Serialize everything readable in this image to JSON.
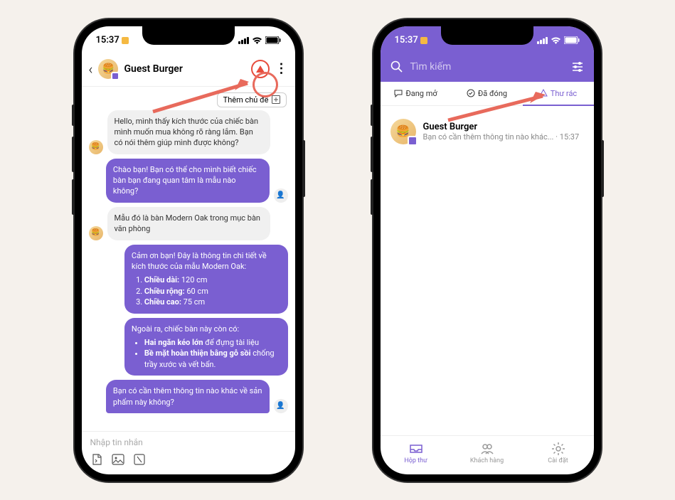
{
  "status": {
    "time": "15:37",
    "yellow_square": "◧"
  },
  "left": {
    "header": {
      "title": "Guest Burger",
      "add_topic": "Thêm chủ đề"
    },
    "messages": {
      "m1": "Hello, mình thấy kích thước của chiếc bàn mình muốn mua không rõ ràng lắm. Bạn có nói thêm giúp mình được không?",
      "m2": "Chào bạn! Bạn có thể cho mình biết chiếc bàn bạn đang quan tâm là mẫu nào không?",
      "m3": "Mẫu đó là bàn Modern Oak trong mục bàn văn phòng",
      "m4_intro": "Cảm ơn bạn! Đây là thông tin chi tiết về kích thước của mẫu Modern Oak:",
      "m4_d1_k": "Chiều dài:",
      "m4_d1_v": " 120 cm",
      "m4_d2_k": "Chiều rộng:",
      "m4_d2_v": " 60 cm",
      "m4_d3_k": "Chiều cao:",
      "m4_d3_v": " 75 cm",
      "m5_intro": "Ngoài ra, chiếc bàn này còn có:",
      "m5_b1_k": "Hai ngăn kéo lớn",
      "m5_b1_v": " để đựng tài liệu",
      "m5_b2_k": "Bề mặt hoàn thiện bằng gỗ sồi",
      "m5_b2_v": " chống trầy xước và vết bẩn.",
      "m6": "Bạn có cần thêm thông tin nào khác về sản phẩm này không?"
    },
    "input_placeholder": "Nhập tin nhắn"
  },
  "right": {
    "search_placeholder": "Tìm kiếm",
    "tabs": {
      "open": "Đang mở",
      "closed": "Đã đóng",
      "spam": "Thư rác"
    },
    "conv": {
      "name": "Guest Burger",
      "preview": "Bạn có cần thêm thông tin nào khác...",
      "time": "15:37"
    },
    "nav": {
      "inbox": "Hộp thư",
      "customers": "Khách hàng",
      "settings": "Cài đặt"
    }
  }
}
